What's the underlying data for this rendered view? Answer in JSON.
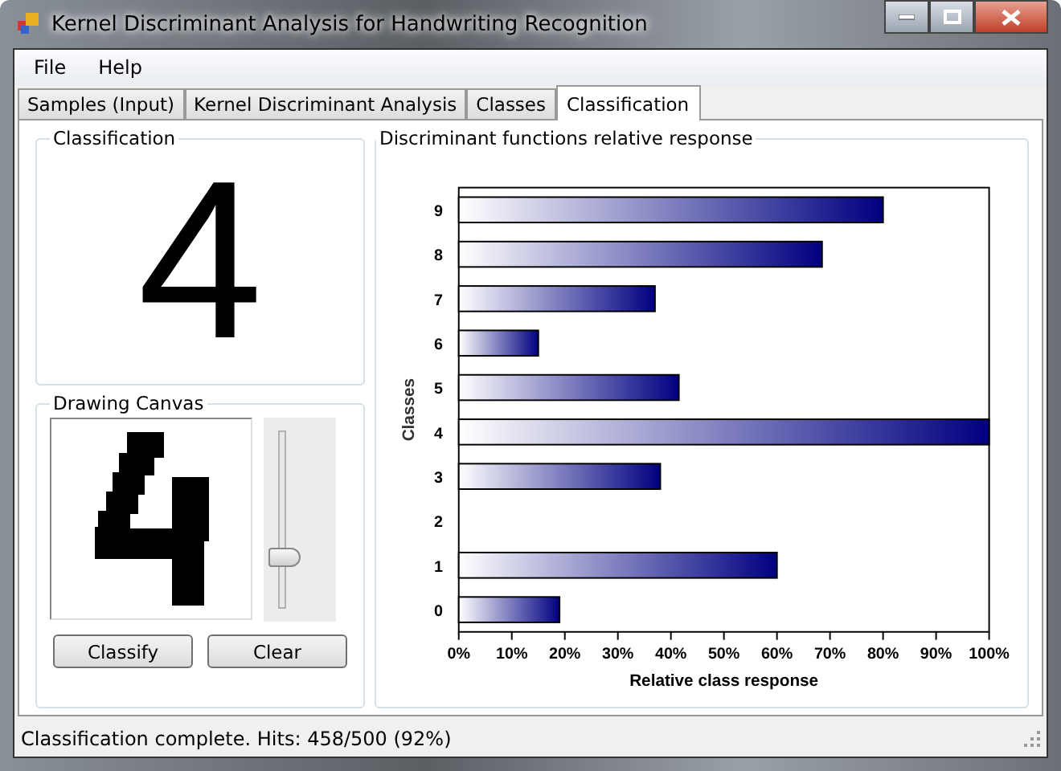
{
  "window": {
    "title": "Kernel Discriminant Analysis for Handwriting Recognition"
  },
  "menu": [
    {
      "label": "File"
    },
    {
      "label": "Help"
    }
  ],
  "tabs": [
    {
      "label": "Samples (Input)",
      "selected": false
    },
    {
      "label": "Kernel Discriminant Analysis",
      "selected": false
    },
    {
      "label": "Classes",
      "selected": false
    },
    {
      "label": "Classification",
      "selected": true
    }
  ],
  "classification": {
    "title": "Classification",
    "result": "4"
  },
  "drawing_canvas": {
    "title": "Drawing Canvas",
    "pen_size": {
      "level": 0.25
    },
    "buttons": [
      "Classify",
      "Clear"
    ]
  },
  "chart_panel": {
    "title": "Discriminant functions relative response",
    "chart_data": {
      "type": "bar",
      "orientation": "horizontal",
      "xlabel": "Relative class response",
      "ylabel": "Classes",
      "categories": [
        "9",
        "8",
        "7",
        "6",
        "5",
        "4",
        "3",
        "2",
        "1",
        "0"
      ],
      "values": [
        0.8,
        0.685,
        0.37,
        0.15,
        0.415,
        1,
        0.38,
        0,
        0.6,
        0.19
      ],
      "xlim": [
        0,
        1
      ],
      "xticks": [
        {
          "value": 0,
          "label": "0%"
        },
        {
          "value": 0.1,
          "label": "10%"
        },
        {
          "value": 0.2,
          "label": "20%"
        },
        {
          "value": 0.3,
          "label": "30%"
        },
        {
          "value": 0.4,
          "label": "40%"
        },
        {
          "value": 0.5,
          "label": "50%"
        },
        {
          "value": 0.6,
          "label": "60%"
        },
        {
          "value": 0.7,
          "label": "70%"
        },
        {
          "value": 0.8,
          "label": "80%"
        },
        {
          "value": 0.9,
          "label": "90%"
        },
        {
          "value": 1,
          "label": "100%"
        }
      ]
    }
  },
  "status_bar": {
    "text": "Classification complete. Hits: 458/500 (92%)"
  }
}
